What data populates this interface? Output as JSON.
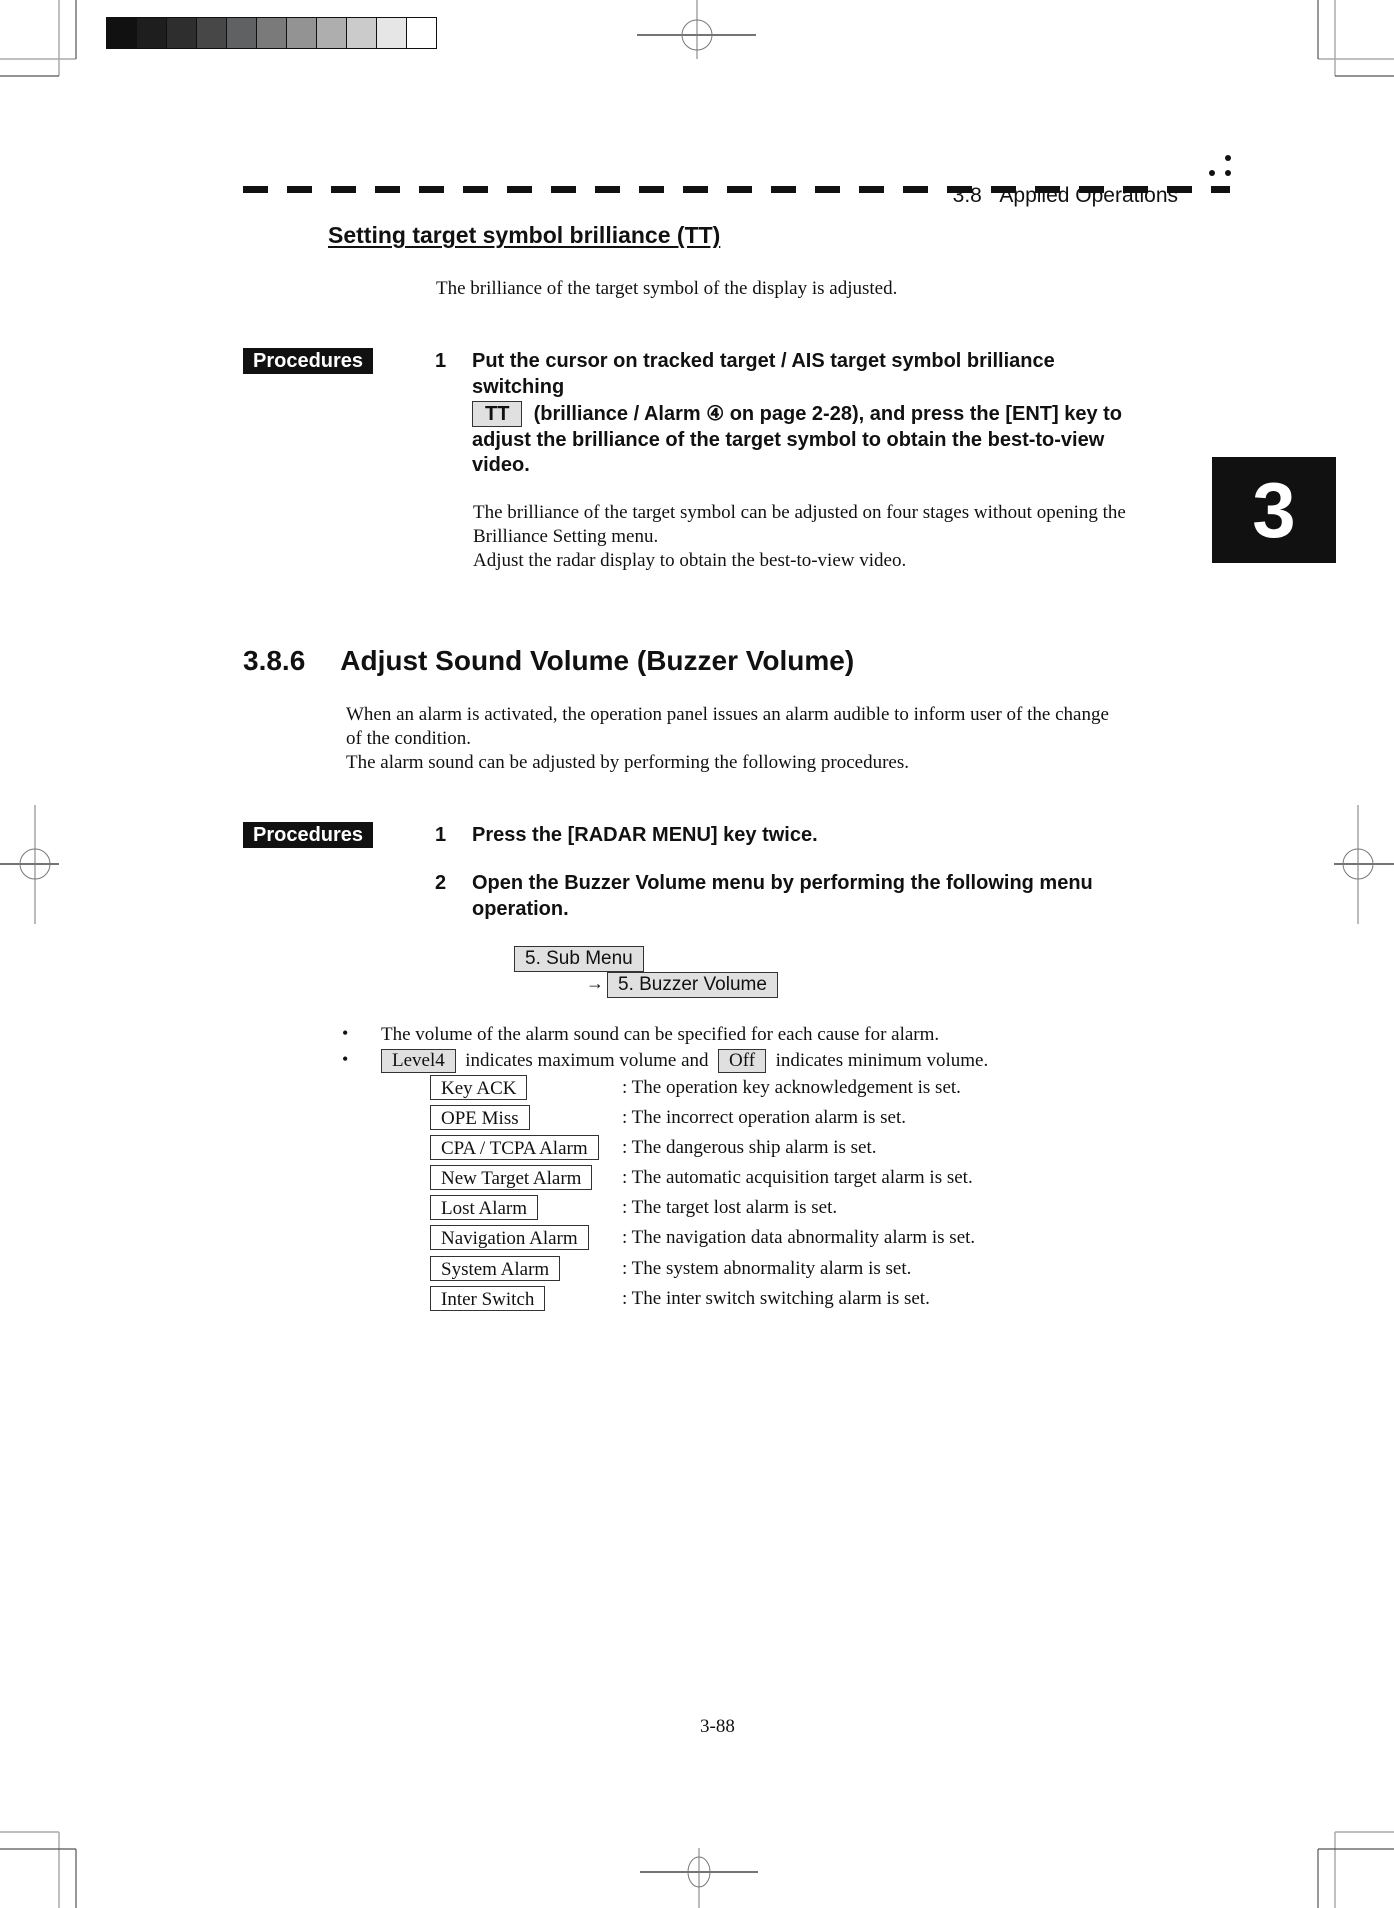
{
  "header": {
    "section_number": "3.8",
    "section_title": "Applied Operations"
  },
  "chapter_tab": "3",
  "target_brilliance": {
    "heading": "Setting target symbol brilliance (TT)",
    "intro": "The brilliance of the target symbol of the display is adjusted.",
    "procedures_label": "Procedures",
    "step": {
      "number": "1",
      "line1": "Put the cursor on tracked target / AIS target symbol brilliance",
      "line2": "switching",
      "key": "TT",
      "line3_rest": "(brilliance / Alarm ④ on page 2-28), and press the [ENT] key to",
      "line4": "adjust the brilliance of the target symbol to obtain the best-to-view",
      "line5": "video."
    },
    "notes": [
      "The brilliance of the target symbol can be adjusted on four stages without opening the",
      "Brilliance Setting menu.",
      "Adjust the radar display to obtain the best-to-view video."
    ]
  },
  "buzzer_volume": {
    "section_number": "3.8.6",
    "section_title": "Adjust Sound Volume (Buzzer Volume)",
    "intro": [
      "When an alarm is activated, the operation panel issues an alarm audible to inform user of the change",
      "of the condition.",
      "The alarm sound can be adjusted by performing the following procedures."
    ],
    "procedures_label": "Procedures",
    "steps": [
      {
        "number": "1",
        "lines": [
          "Press the [RADAR MENU] key twice."
        ]
      },
      {
        "number": "2",
        "lines": [
          "Open the Buzzer Volume menu by performing the following menu",
          "operation."
        ]
      }
    ],
    "menu_path": {
      "item1": "5. Sub Menu",
      "arrow": "→",
      "item2": "5. Buzzer Volume"
    },
    "bullets": {
      "b1": "The volume of the alarm sound can be specified for each cause for alarm.",
      "b2_max_key": "Level4",
      "b2_mid": "indicates maximum volume and",
      "b2_min_key": "Off",
      "b2_end": "indicates minimum volume."
    },
    "alarm_items": [
      {
        "label": "Key ACK",
        "desc": ": The operation key acknowledgement is set."
      },
      {
        "label": "OPE Miss",
        "desc": ": The incorrect operation alarm is set."
      },
      {
        "label": "CPA / TCPA Alarm",
        "desc": ": The dangerous ship alarm is set."
      },
      {
        "label": "New Target Alarm",
        "desc": ": The automatic acquisition target alarm is set."
      },
      {
        "label": "Lost Alarm",
        "desc": ": The target lost alarm is set."
      },
      {
        "label": "Navigation Alarm",
        "desc": ": The navigation data abnormality alarm is set."
      },
      {
        "label": "System Alarm",
        "desc": ": The system abnormality alarm is set."
      },
      {
        "label": "Inter Switch",
        "desc": ": The inter switch switching alarm is set."
      }
    ]
  },
  "page_number": "3-88",
  "gray_scale": [
    "#111111",
    "#1e1e1e",
    "#2e2e2e",
    "#474747",
    "#606162",
    "#7a7a7a",
    "#939393",
    "#aeaeae",
    "#cbcbcb",
    "#e6e6e6",
    "#ffffff"
  ]
}
